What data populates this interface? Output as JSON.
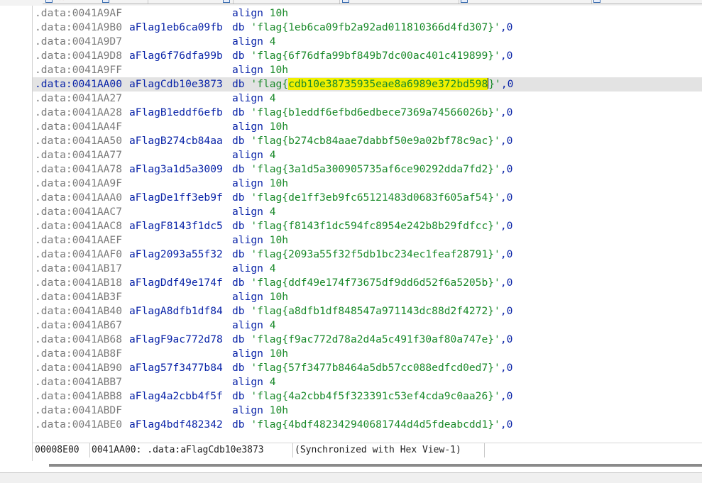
{
  "rows": [
    {
      "addr": ".data:0041A9AF",
      "label": "",
      "mnemonic": "align",
      "operand": "10h"
    },
    {
      "addr": ".data:0041A9B0",
      "label": "aFlag1eb6ca09fb",
      "mnemonic": "db",
      "flag": "1eb6ca09fb2a92ad011810366d4fd307"
    },
    {
      "addr": ".data:0041A9D7",
      "label": "",
      "mnemonic": "align",
      "operand": "4"
    },
    {
      "addr": ".data:0041A9D8",
      "label": "aFlag6f76dfa99b",
      "mnemonic": "db",
      "flag": "6f76dfa99bf849b7dc00ac401c419899"
    },
    {
      "addr": ".data:0041A9FF",
      "label": "",
      "mnemonic": "align",
      "operand": "10h"
    },
    {
      "addr": ".data:0041AA00",
      "label": "aFlagCdb10e3873",
      "mnemonic": "db",
      "flag": "cdb10e38735935eae8a6989e372bd598",
      "current": true
    },
    {
      "addr": ".data:0041AA27",
      "label": "",
      "mnemonic": "align",
      "operand": "4"
    },
    {
      "addr": ".data:0041AA28",
      "label": "aFlagB1eddf6efb",
      "mnemonic": "db",
      "flag": "b1eddf6efbd6edbece7369a74566026b"
    },
    {
      "addr": ".data:0041AA4F",
      "label": "",
      "mnemonic": "align",
      "operand": "10h"
    },
    {
      "addr": ".data:0041AA50",
      "label": "aFlagB274cb84aa",
      "mnemonic": "db",
      "flag": "b274cb84aae7dabbf50e9a02bf78c9ac"
    },
    {
      "addr": ".data:0041AA77",
      "label": "",
      "mnemonic": "align",
      "operand": "4"
    },
    {
      "addr": ".data:0041AA78",
      "label": "aFlag3a1d5a3009",
      "mnemonic": "db",
      "flag": "3a1d5a300905735af6ce90292dda7fd2"
    },
    {
      "addr": ".data:0041AA9F",
      "label": "",
      "mnemonic": "align",
      "operand": "10h"
    },
    {
      "addr": ".data:0041AAA0",
      "label": "aFlagDe1ff3eb9f",
      "mnemonic": "db",
      "flag": "de1ff3eb9fc65121483d0683f605af54"
    },
    {
      "addr": ".data:0041AAC7",
      "label": "",
      "mnemonic": "align",
      "operand": "4"
    },
    {
      "addr": ".data:0041AAC8",
      "label": "aFlagF8143f1dc5",
      "mnemonic": "db",
      "flag": "f8143f1dc594fc8954e242b8b29fdfcc"
    },
    {
      "addr": ".data:0041AAEF",
      "label": "",
      "mnemonic": "align",
      "operand": "10h"
    },
    {
      "addr": ".data:0041AAF0",
      "label": "aFlag2093a55f32",
      "mnemonic": "db",
      "flag": "2093a55f32f5db1bc234ec1feaf28791"
    },
    {
      "addr": ".data:0041AB17",
      "label": "",
      "mnemonic": "align",
      "operand": "4"
    },
    {
      "addr": ".data:0041AB18",
      "label": "aFlagDdf49e174f",
      "mnemonic": "db",
      "flag": "ddf49e174f73675df9dd6d52f6a5205b"
    },
    {
      "addr": ".data:0041AB3F",
      "label": "",
      "mnemonic": "align",
      "operand": "10h"
    },
    {
      "addr": ".data:0041AB40",
      "label": "aFlagA8dfb1df84",
      "mnemonic": "db",
      "flag": "a8dfb1df848547a971143dc88d2f4272"
    },
    {
      "addr": ".data:0041AB67",
      "label": "",
      "mnemonic": "align",
      "operand": "4"
    },
    {
      "addr": ".data:0041AB68",
      "label": "aFlagF9ac772d78",
      "mnemonic": "db",
      "flag": "f9ac772d78a2d4a5c491f30af80a747e"
    },
    {
      "addr": ".data:0041AB8F",
      "label": "",
      "mnemonic": "align",
      "operand": "10h"
    },
    {
      "addr": ".data:0041AB90",
      "label": "aFlag57f3477b84",
      "mnemonic": "db",
      "flag": "57f3477b8464a5db57cc088edfcd0ed7"
    },
    {
      "addr": ".data:0041ABB7",
      "label": "",
      "mnemonic": "align",
      "operand": "4"
    },
    {
      "addr": ".data:0041ABB8",
      "label": "aFlag4a2cbb4f5f",
      "mnemonic": "db",
      "flag": "4a2cbb4f5f323391c53ef4cda9c0aa26"
    },
    {
      "addr": ".data:0041ABDF",
      "label": "",
      "mnemonic": "align",
      "operand": "10h"
    },
    {
      "addr": ".data:0041ABE0",
      "label": "aFlag4bdf482342",
      "mnemonic": "db",
      "flag": "4bdf482342940681744d4d5fdeabcdd1"
    }
  ],
  "string_prefix": "'flag{",
  "string_suffix": "}'",
  "string_tail": ",0",
  "status": {
    "offset": "00008E00",
    "location": "0041AA00: .data:aFlagCdb10e3873",
    "sync": "(Synchronized with Hex View-1)"
  },
  "colors": {
    "address": "#7a7a7a",
    "label": "#0a24a8",
    "string": "#1a8a2a",
    "highlight": "#f0f000",
    "current_line": "#e3e3e3",
    "breakpoint_dot": "#6fb8e8"
  }
}
